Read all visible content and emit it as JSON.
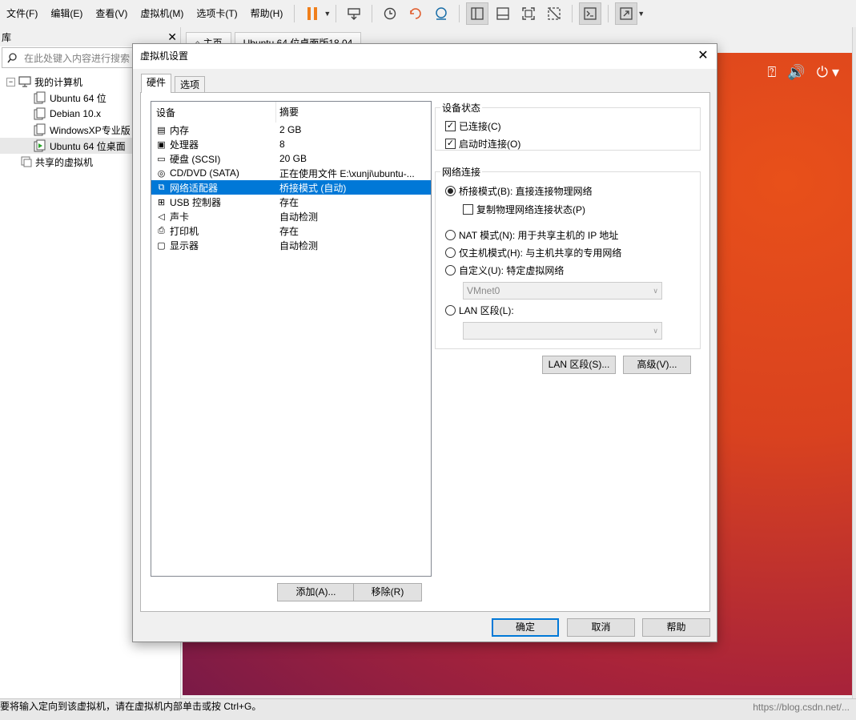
{
  "menubar": {
    "items": [
      "文件(F)",
      "编辑(E)",
      "查看(V)",
      "虚拟机(M)",
      "选项卡(T)",
      "帮助(H)"
    ]
  },
  "library": {
    "title": "库",
    "search_placeholder": "在此处键入内容进行搜索",
    "root": "我的计算机",
    "vms": [
      "Ubuntu 64 位",
      "Debian 10.x",
      "WindowsXP专业版",
      "Ubuntu 64 位桌面"
    ],
    "shared": "共享的虚拟机"
  },
  "workspace": {
    "tabs": [
      "主页",
      "Ubuntu 64 位桌面版18.04"
    ]
  },
  "statusbar": {
    "text": "要将输入定向到该虚拟机，请在虚拟机内部单击或按 Ctrl+G。",
    "watermark": "https://blog.csdn.net/..."
  },
  "dialog": {
    "title": "虚拟机设置",
    "tabs": [
      "硬件",
      "选项"
    ],
    "columns": [
      "设备",
      "摘要"
    ],
    "devices": [
      {
        "name": "内存",
        "summary": "2 GB",
        "icon": "memory-icon"
      },
      {
        "name": "处理器",
        "summary": "8",
        "icon": "cpu-icon"
      },
      {
        "name": "硬盘 (SCSI)",
        "summary": "20 GB",
        "icon": "disk-icon"
      },
      {
        "name": "CD/DVD (SATA)",
        "summary": "正在使用文件 E:\\xunji\\ubuntu-...",
        "icon": "cd-icon"
      },
      {
        "name": "网络适配器",
        "summary": "桥接模式 (自动)",
        "icon": "network-icon"
      },
      {
        "name": "USB 控制器",
        "summary": "存在",
        "icon": "usb-icon"
      },
      {
        "name": "声卡",
        "summary": "自动检测",
        "icon": "sound-icon"
      },
      {
        "name": "打印机",
        "summary": "存在",
        "icon": "printer-icon"
      },
      {
        "name": "显示器",
        "summary": "自动检测",
        "icon": "display-icon"
      }
    ],
    "selected_device_index": 4,
    "add_label": "添加(A)...",
    "remove_label": "移除(R)",
    "device_status": {
      "title": "设备状态",
      "connected": "已连接(C)",
      "connect_on_start": "启动时连接(O)"
    },
    "network": {
      "title": "网络连接",
      "bridged": "桥接模式(B): 直接连接物理网络",
      "replicate": "复制物理网络连接状态(P)",
      "nat": "NAT 模式(N): 用于共享主机的 IP 地址",
      "host_only": "仅主机模式(H): 与主机共享的专用网络",
      "custom": "自定义(U): 特定虚拟网络",
      "custom_value": "VMnet0",
      "lan": "LAN 区段(L):",
      "lan_value": ""
    },
    "lan_segments_label": "LAN 区段(S)...",
    "advanced_label": "高级(V)...",
    "ok_label": "确定",
    "cancel_label": "取消",
    "help_label": "帮助"
  }
}
